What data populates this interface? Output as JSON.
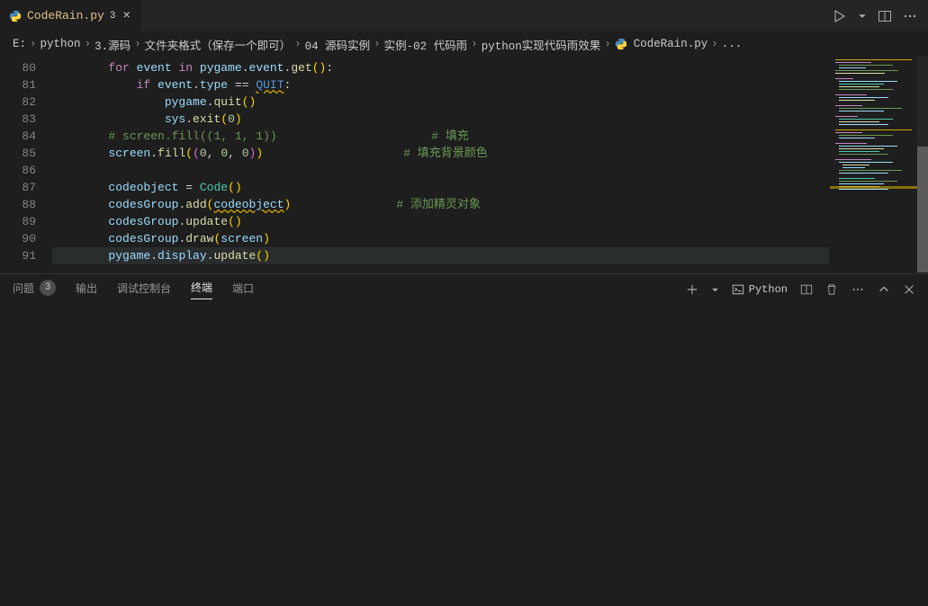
{
  "tab": {
    "filename": "CodeRain.py",
    "badge": "3"
  },
  "breadcrumb": {
    "items": [
      "E:",
      "python",
      "3.源码",
      "文件夹格式（保存一个即可）",
      "04 源码实例",
      "实例-02 代码雨",
      "python实现代码雨效果"
    ],
    "file": "CodeRain.py",
    "tail": "..."
  },
  "lines": [
    80,
    81,
    82,
    83,
    84,
    85,
    86,
    87,
    88,
    89,
    90,
    91
  ],
  "code": {
    "l80": {
      "kw1": "for",
      "var1": "event",
      "kw2": "in",
      "var2": "pygame",
      "fn": "event",
      "fn2": "get"
    },
    "l81": {
      "kw": "if",
      "var": "event",
      "prop": "type",
      "cst": "QUIT"
    },
    "l82": {
      "var": "pygame",
      "fn": "quit"
    },
    "l83": {
      "var": "sys",
      "fn": "exit",
      "num": "0"
    },
    "l84": {
      "cm": "# screen.fill((1, 1, 1))",
      "cm2": "# 填充"
    },
    "l85": {
      "var": "screen",
      "fn": "fill",
      "n1": "0",
      "n2": "0",
      "n3": "0",
      "cm": "# 填充背景颜色"
    },
    "l87": {
      "var": "codeobject",
      "cls": "Code"
    },
    "l88": {
      "var": "codesGroup",
      "fn": "add",
      "arg": "codeobject",
      "cm": "# 添加精灵对象"
    },
    "l89": {
      "var": "codesGroup",
      "fn": "update"
    },
    "l90": {
      "var": "codesGroup",
      "fn": "draw",
      "arg": "screen"
    },
    "l91": {
      "var": "pygame",
      "prop": "display",
      "fn": "update"
    }
  },
  "panel": {
    "tabs": {
      "problems": "问题",
      "problems_count": "3",
      "output": "输出",
      "debug": "调试控制台",
      "terminal": "终端",
      "ports": "端口"
    },
    "terminal_kind": "Python"
  }
}
